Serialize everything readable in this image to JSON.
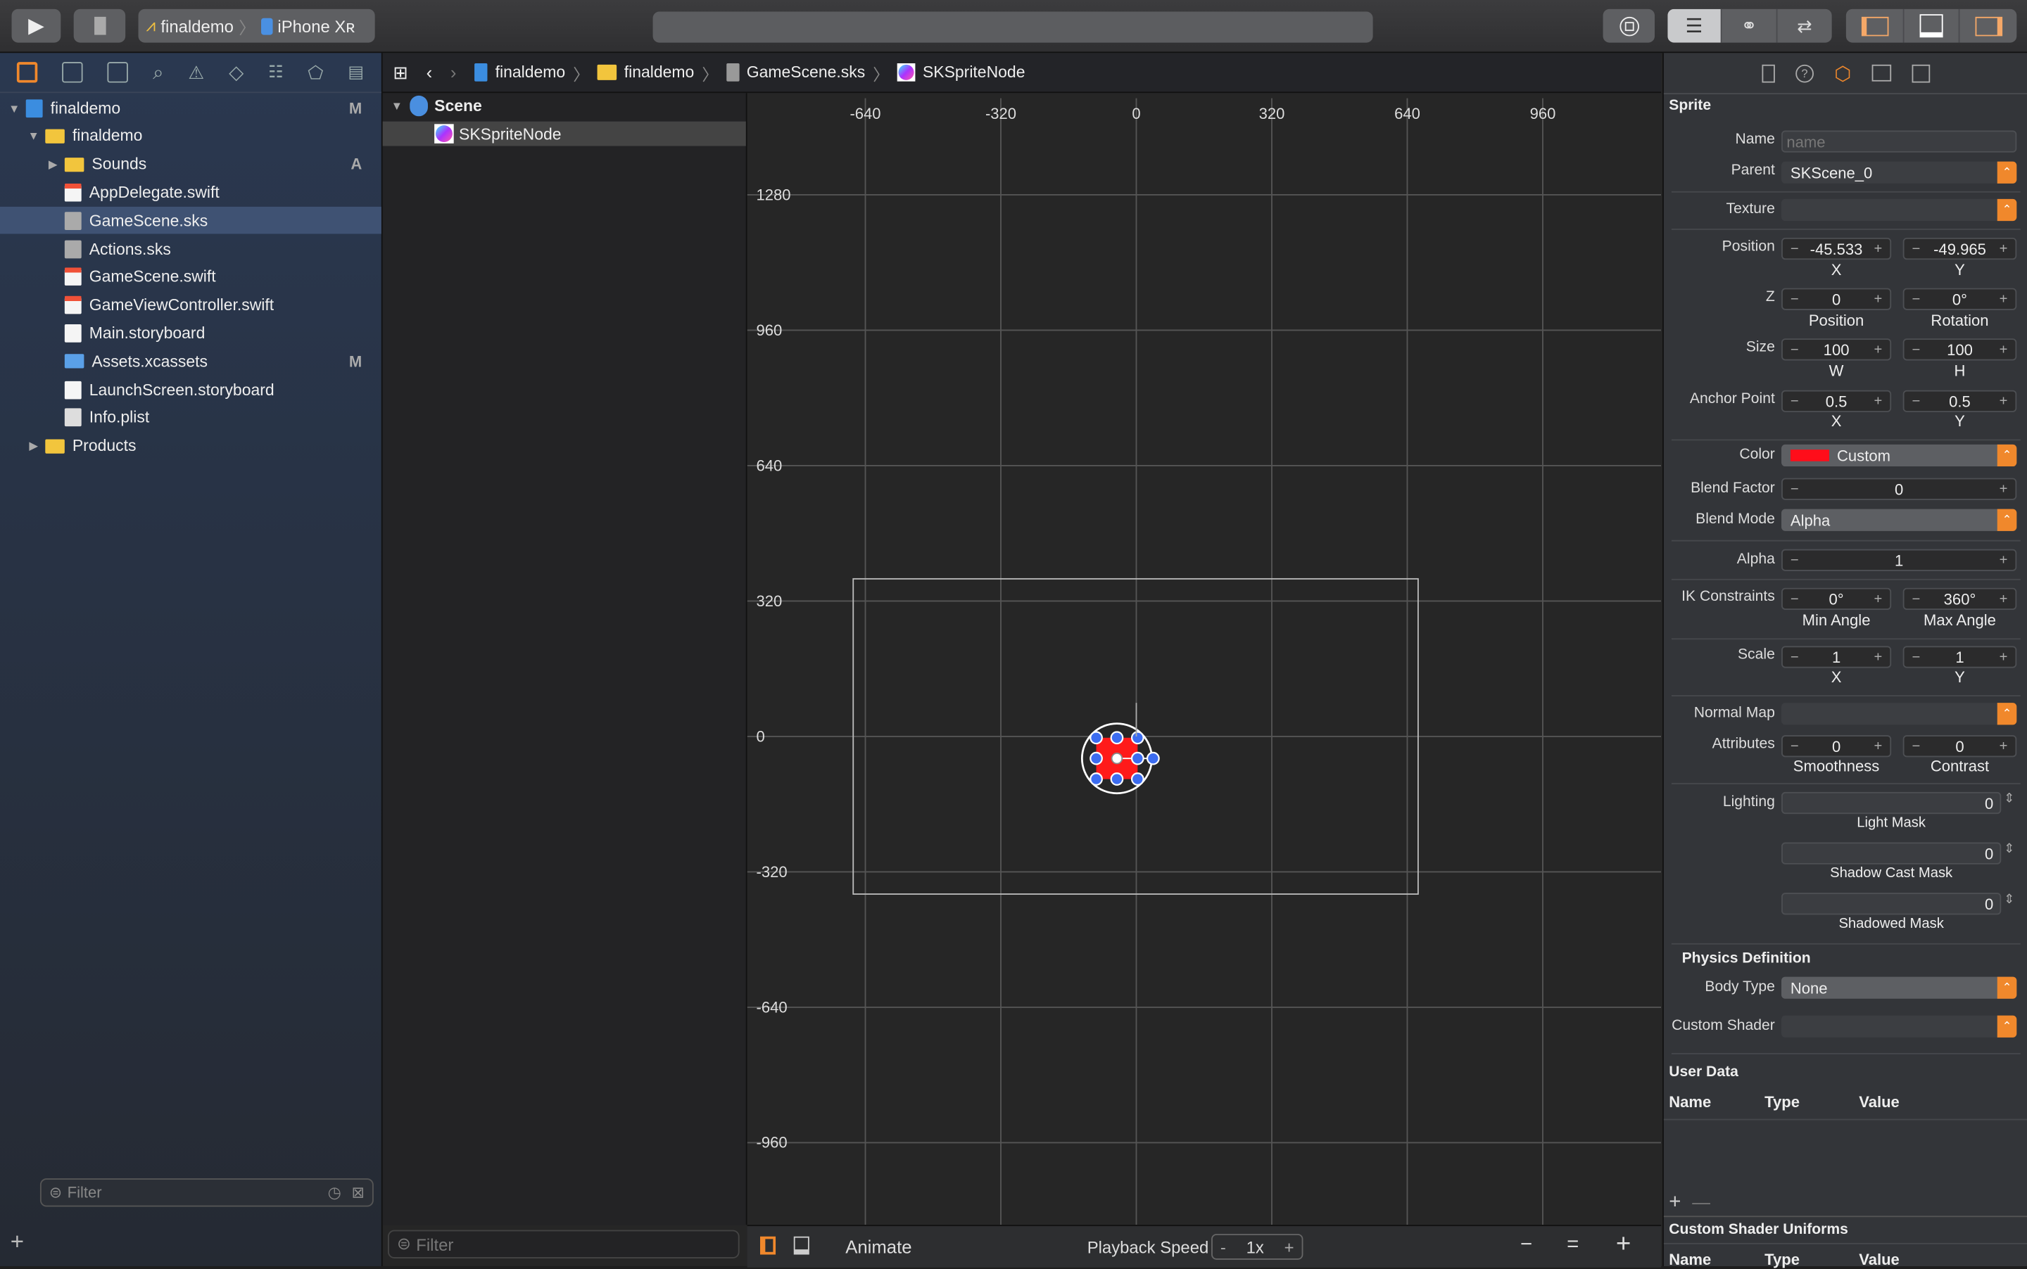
{
  "toolbar": {
    "scheme_project": "finaldemo",
    "scheme_device": "iPhone Xʀ",
    "run_icon": "play-icon",
    "stop_icon": "stop-icon",
    "accent": "#f0882c"
  },
  "navigator": {
    "items": [
      {
        "label": "finaldemo",
        "icon": "project",
        "level": 0,
        "disclosure": "▼",
        "badge": "M"
      },
      {
        "label": "finaldemo",
        "icon": "folder",
        "level": 1,
        "disclosure": "▼",
        "badge": ""
      },
      {
        "label": "Sounds",
        "icon": "folder",
        "level": 2,
        "disclosure": "▶",
        "badge": "A"
      },
      {
        "label": "AppDelegate.swift",
        "icon": "swift",
        "level": 2,
        "disclosure": "",
        "badge": ""
      },
      {
        "label": "GameScene.sks",
        "icon": "sks",
        "level": 2,
        "disclosure": "",
        "badge": "",
        "selected": true
      },
      {
        "label": "Actions.sks",
        "icon": "sks",
        "level": 2,
        "disclosure": "",
        "badge": ""
      },
      {
        "label": "GameScene.swift",
        "icon": "swift",
        "level": 2,
        "disclosure": "",
        "badge": ""
      },
      {
        "label": "GameViewController.swift",
        "icon": "swift",
        "level": 2,
        "disclosure": "",
        "badge": ""
      },
      {
        "label": "Main.storyboard",
        "icon": "storyboard",
        "level": 2,
        "disclosure": "",
        "badge": ""
      },
      {
        "label": "Assets.xcassets",
        "icon": "assets",
        "level": 2,
        "disclosure": "",
        "badge": "M"
      },
      {
        "label": "LaunchScreen.storyboard",
        "icon": "storyboard",
        "level": 2,
        "disclosure": "",
        "badge": ""
      },
      {
        "label": "Info.plist",
        "icon": "plist",
        "level": 2,
        "disclosure": "",
        "badge": ""
      },
      {
        "label": "Products",
        "icon": "folder",
        "level": 1,
        "disclosure": "▶",
        "badge": ""
      }
    ],
    "filter_placeholder": "Filter"
  },
  "breadcrumb": [
    "finaldemo",
    "finaldemo",
    "GameScene.sks",
    "SKSpriteNode"
  ],
  "outline": {
    "items": [
      {
        "label": "Scene"
      },
      {
        "label": "SKSpriteNode"
      }
    ],
    "filter_placeholder": "Filter"
  },
  "canvas": {
    "x_ticks": [
      -640,
      -320,
      0,
      320,
      640,
      960
    ],
    "y_ticks": [
      1280,
      960,
      640,
      320,
      0,
      -320,
      -640,
      -960
    ],
    "sprite_color": "#ff1a1a"
  },
  "bottom": {
    "animate": "Animate",
    "playback_label": "Playback Speed",
    "playback_value": "1x",
    "minus": "-",
    "plus": "+",
    "zoom_out": "−",
    "zoom_reset": "=",
    "zoom_in": "+"
  },
  "inspector": {
    "section": "Sprite",
    "name_label": "Name",
    "name_placeholder": "name",
    "parent_label": "Parent",
    "parent_value": "SKScene_0",
    "texture_label": "Texture",
    "position": {
      "label": "Position",
      "x": "-45.533",
      "y": "-49.965",
      "sub_x": "X",
      "sub_y": "Y"
    },
    "z": {
      "label": "Z",
      "position": "0",
      "rotation": "0°",
      "sub_a": "Position",
      "sub_b": "Rotation"
    },
    "size": {
      "label": "Size",
      "w": "100",
      "h": "100",
      "sub_a": "W",
      "sub_b": "H"
    },
    "anchor": {
      "label": "Anchor Point",
      "x": "0.5",
      "y": "0.5",
      "sub_a": "X",
      "sub_b": "Y"
    },
    "color": {
      "label": "Color",
      "value": "Custom",
      "swatch": "#ff0d1a"
    },
    "blend_factor": {
      "label": "Blend Factor",
      "value": "0"
    },
    "blend_mode": {
      "label": "Blend Mode",
      "value": "Alpha"
    },
    "alpha": {
      "label": "Alpha",
      "value": "1"
    },
    "ik": {
      "label": "IK Constraints",
      "min": "0°",
      "max": "360°",
      "sub_a": "Min Angle",
      "sub_b": "Max Angle"
    },
    "scale": {
      "label": "Scale",
      "x": "1",
      "y": "1",
      "sub_a": "X",
      "sub_b": "Y"
    },
    "normal_map_label": "Normal Map",
    "attributes": {
      "label": "Attributes",
      "smoothness": "0",
      "contrast": "0",
      "sub_a": "Smoothness",
      "sub_b": "Contrast"
    },
    "lighting": {
      "label": "Lighting",
      "light_mask": "0",
      "light_mask_label": "Light Mask",
      "shadow_cast": "0",
      "shadow_cast_label": "Shadow Cast Mask",
      "shadowed": "0",
      "shadowed_label": "Shadowed Mask"
    },
    "physics": {
      "title": "Physics Definition",
      "body_type_label": "Body Type",
      "body_type": "None"
    },
    "custom_shader_label": "Custom Shader",
    "user_data": {
      "title": "User Data",
      "columns": [
        "Name",
        "Type",
        "Value"
      ]
    },
    "uniforms": {
      "title": "Custom Shader Uniforms",
      "columns": [
        "Name",
        "Type",
        "Value"
      ]
    }
  }
}
